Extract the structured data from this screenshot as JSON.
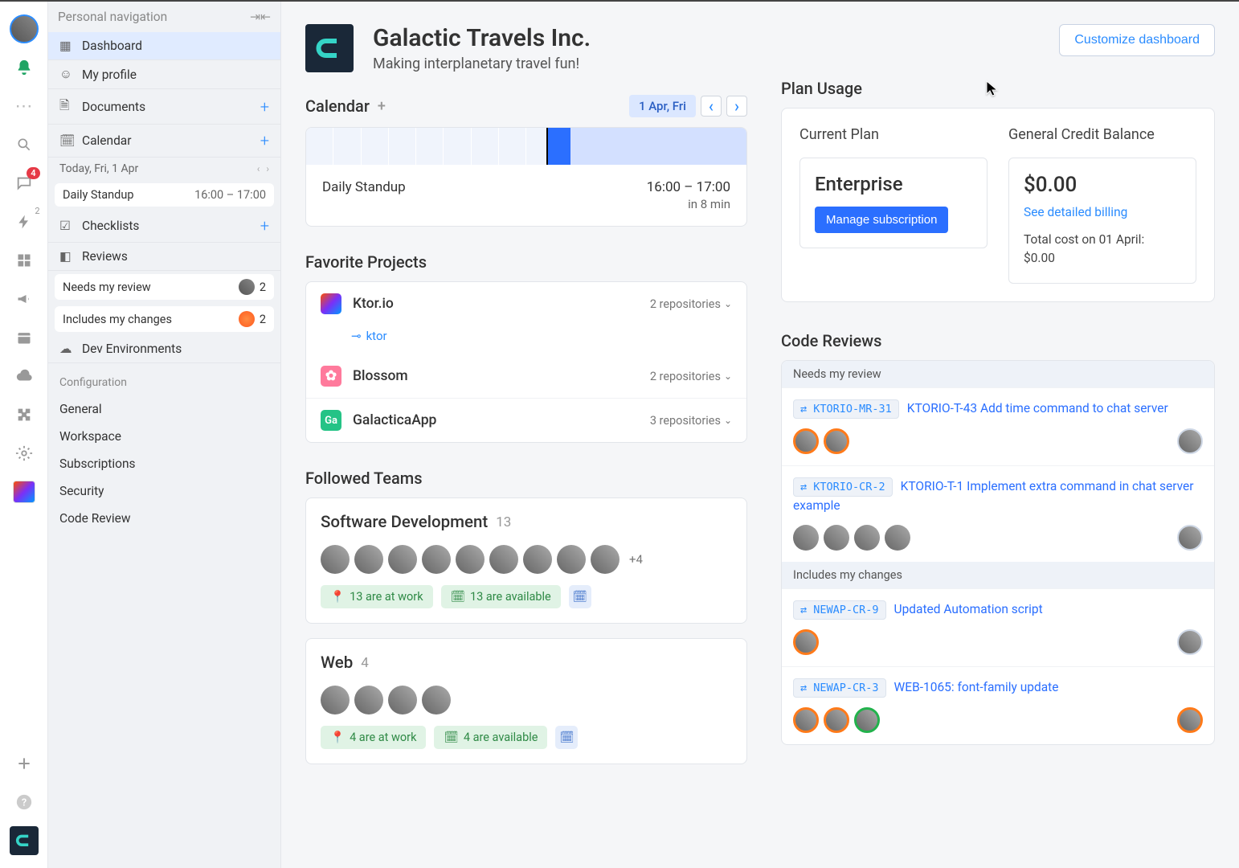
{
  "sidebar": {
    "header": "Personal navigation",
    "items": {
      "dashboard": "Dashboard",
      "profile": "My profile",
      "documents": "Documents",
      "calendar": "Calendar",
      "checklists": "Checklists",
      "reviews": "Reviews",
      "dev_env": "Dev Environments"
    },
    "today_label": "Today, Fri, 1 Apr",
    "meeting_name": "Daily Standup",
    "meeting_time": "16:00 – 17:00",
    "needs_review": "Needs my review",
    "needs_count": "2",
    "includes_changes": "Includes my changes",
    "includes_count": "2",
    "config_label": "Configuration",
    "config": {
      "general": "General",
      "workspace": "Workspace",
      "subscriptions": "Subscriptions",
      "security": "Security",
      "code_review": "Code Review"
    }
  },
  "rail": {
    "chat_badge": "4",
    "bolt_badge": "2"
  },
  "header": {
    "org_name": "Galactic Travels Inc.",
    "org_tag": "Making interplanetary travel fun!",
    "customize": "Customize dashboard"
  },
  "calendar": {
    "title": "Calendar",
    "date": "1 Apr, Fri",
    "event_name": "Daily Standup",
    "event_time": "16:00 – 17:00",
    "event_in": "in 8 min"
  },
  "plan": {
    "section": "Plan Usage",
    "current_label": "Current Plan",
    "plan_name": "Enterprise",
    "manage": "Manage subscription",
    "balance_label": "General Credit Balance",
    "balance": "$0.00",
    "billing_link": "See detailed billing",
    "cost_line1": "Total cost on 01 April:",
    "cost_line2": "$0.00"
  },
  "fav": {
    "title": "Favorite Projects",
    "projects": [
      {
        "name": "Ktor.io",
        "repos": "2 repositories"
      },
      {
        "name": "Blossom",
        "repos": "2 repositories"
      },
      {
        "name": "GalacticaApp",
        "repos": "3 repositories"
      }
    ],
    "ktor_sub": "ktor",
    "gal_abbr": "Ga"
  },
  "teams": {
    "title": "Followed Teams",
    "t1_name": "Software Development",
    "t1_count": "13",
    "t1_more": "+4",
    "t1_work": "13 are at work",
    "t1_avail": "13 are available",
    "t2_name": "Web",
    "t2_count": "4",
    "t2_work": "4 are at work",
    "t2_avail": "4 are available"
  },
  "reviews": {
    "title": "Code Reviews",
    "h1": "Needs my review",
    "h2": "Includes my changes",
    "r1_badge": "KTORIO-MR-31",
    "r1_title": "KTORIO-T-43 Add time command to chat server",
    "r2_badge": "KTORIO-CR-2",
    "r2_title": "KTORIO-T-1 Implement extra command in chat server example",
    "r3_badge": "NEWAP-CR-9",
    "r3_title": "Updated Automation script",
    "r4_badge": "NEWAP-CR-3",
    "r4_title": "WEB-1065: font-family update"
  }
}
